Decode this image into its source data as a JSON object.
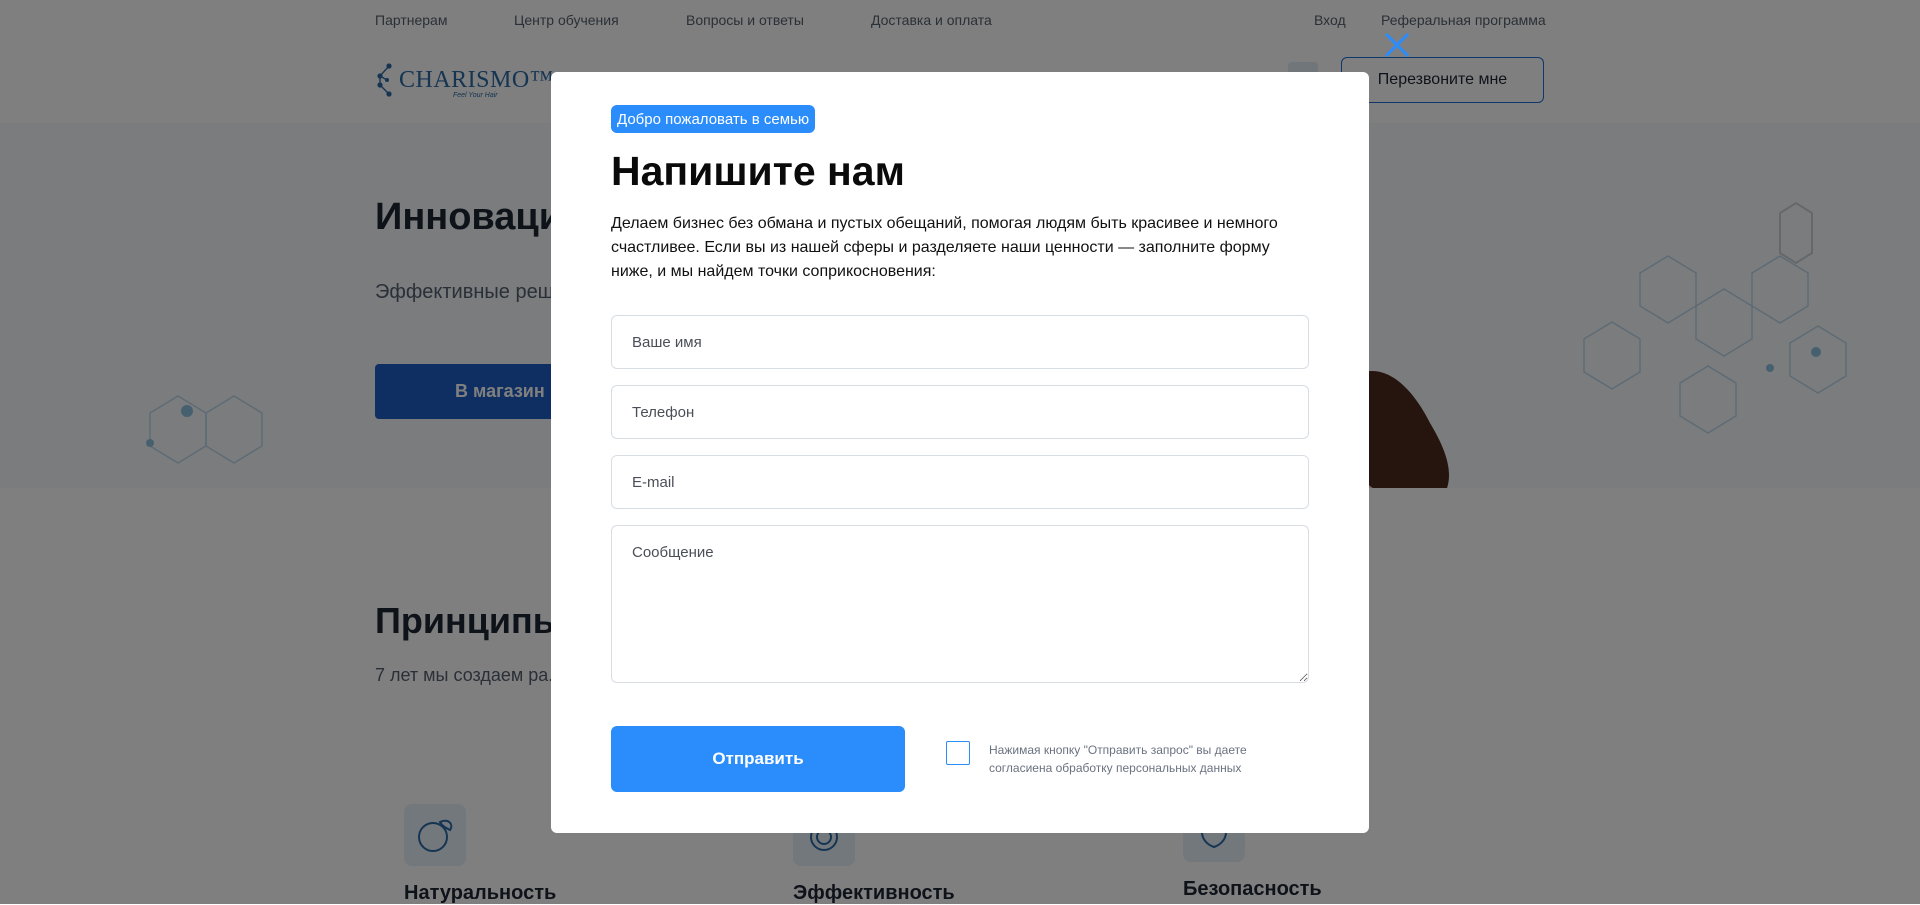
{
  "topnav": {
    "items": [
      "Партнерам",
      "Центр обучения",
      "Вопросы и ответы",
      "Доставка и оплата"
    ],
    "login": "Вход",
    "referral": "Реферальная программа"
  },
  "header": {
    "logo_text": "CHARISMO™",
    "logo_tagline": "Feel Your Hair",
    "callback_label": "Перезвоните мне"
  },
  "hero": {
    "title": "Инновации",
    "subtitle": "Эффективные реш... рекомендуемые пр...",
    "shop_button": "В магазин"
  },
  "principles": {
    "title": "Принципы",
    "subtitle": "7 лет мы создаем ра... принципам работы н...",
    "features": [
      "Натуральность",
      "Эффективность",
      "Безопасность"
    ]
  },
  "modal": {
    "badge": "Добро пожаловать в семью",
    "title": "Напишите нам",
    "description": "Делаем бизнес без обмана и пустых обещаний, помогая людям быть красивее и немного счастливее. Если вы из нашей сферы и разделяете наши ценности — заполните форму ниже, и мы найдем точки соприкосновения:",
    "fields": {
      "name_placeholder": "Ваше имя",
      "phone_placeholder": "Телефон",
      "email_placeholder": "E-mail",
      "message_placeholder": "Сообщение"
    },
    "submit_label": "Отправить",
    "consent_text": "Нажимая кнопку \"Отправить запрос\" вы даете согласиена обработку персональных данных",
    "consent_checked": false
  },
  "icons": {
    "close": "close-icon",
    "logo": "molecule-logo-icon",
    "search": "search-icon",
    "features": [
      "globe-leaf-icon",
      "spiral-icon",
      "shield-hand-icon"
    ]
  },
  "colors": {
    "accent": "#2b8cfb",
    "hero_button": "#1e5fc7",
    "overlay": "rgba(0,0,0,0.5)"
  }
}
